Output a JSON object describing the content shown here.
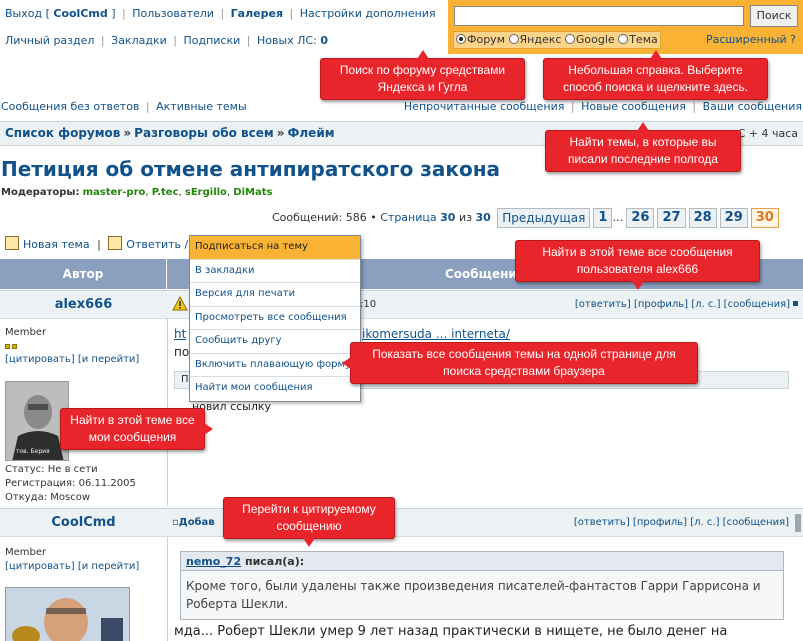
{
  "topbar": {
    "row1": {
      "logout_prefix": "Выход [",
      "logout_user": "CoolCmd",
      "logout_suffix": "]",
      "users": "Пользователи",
      "gallery": "Галерея",
      "addon_settings": "Настройки дополнения"
    },
    "row2": {
      "personal": "Личный раздел",
      "bookmarks": "Закладки",
      "subscriptions": "Подписки",
      "new_pm_label": "Новых ЛС:",
      "new_pm_count": "0"
    }
  },
  "search": {
    "button": "Поиск",
    "value": "",
    "options": [
      "Форум",
      "Яндекс",
      "Google",
      "Тема"
    ],
    "selected": "Форум",
    "advanced": "Расширенный",
    "help": "?"
  },
  "links": {
    "left": [
      "Сообщения без ответов",
      "Активные темы"
    ],
    "right": [
      "Непрочитанные сообщения",
      "Новые сообщения",
      "Ваши сообщения"
    ]
  },
  "breadcrumbs": [
    "Список форумов",
    "Разговоры обо всем",
    "Флейм"
  ],
  "timezone": "C + 4 часа",
  "topic": {
    "title": "Петиция об отмене антипиратского закона",
    "moderators_label": "Модераторы:",
    "moderators": [
      "master-pro",
      "P.tec",
      "sErgillo",
      "DiMats"
    ]
  },
  "pagination": {
    "messages_label": "Сообщений:",
    "messages_count": "586",
    "page_label": "Страница",
    "page_current": "30",
    "page_of": "из",
    "page_total": "30",
    "prev": "Предыдущая",
    "pages": [
      "1",
      "…",
      "26",
      "27",
      "28",
      "29",
      "30"
    ]
  },
  "actions": {
    "new_topic": "Новая тема",
    "reply": "Ответить"
  },
  "dropdown": [
    "Подписаться на тему",
    "В закладки",
    "Версия для печати",
    "Просмотреть все сообщения",
    "Сообщить другу",
    "Включить плавающую форму",
    "Найти мои сообщения"
  ],
  "table": {
    "author_col": "Автор",
    "messages_col": "Сообщение"
  },
  "posts": [
    {
      "author": "alex666",
      "rank": "Member",
      "cite": "[цитировать]",
      "goto": "[и перейти]",
      "status": "Статус: Не в сети",
      "registered": "Регистрация: 06.11.2005",
      "from": "Откуда: Moscow",
      "avatar_caption": "тов. Берия",
      "time_fragment": ":10",
      "links": [
        "[ответить]",
        "[профиль]",
        "[л. с.]",
        "[сообщения]"
      ],
      "body_link_start": "ht",
      "body_link_end": "ikomersuda ... interneta/",
      "body_line2": "по",
      "edit_prefix": "П",
      "edit_text": "новил ссылку"
    },
    {
      "author": "CoolCmd",
      "rank": "Member",
      "cite": "[цитировать]",
      "goto": "[и перейти]",
      "added_fragment": "Добав",
      "links": [
        "[ответить]",
        "[профиль]",
        "[л. с.]",
        "[сообщения]"
      ],
      "quote_author": "nemo_72",
      "quote_said": "писал(а):",
      "quote_text": "Кроме того, были удалены также произведения писателей-фантастов Гарри Гаррисона и Роберта Шекли.",
      "body": "мда... Роберт Шекли умер 9 лет назад практически в нищете, не было денег на"
    }
  ],
  "callouts": {
    "search_forum": "Поиск по форуму средствами Яндекса и Гугла",
    "search_help": "Небольшая справка. Выберите способ поиска и щелкните здесь.",
    "your_topics": "Найти темы, в которые вы писали последние полгода",
    "user_posts": "Найти в этой теме все сообщения пользователя alex666",
    "show_all": "Показать все сообщения темы на одной странице для поиска средствами браузера",
    "my_posts": "Найти в этой теме все мои сообщения",
    "goto_quote": "Перейти к цитируемому сообщению"
  },
  "colors": {
    "accent": "#f9b234",
    "link": "#105289",
    "callout": "#e8252b",
    "header": "#8aa0be",
    "moderator": "#23870a"
  }
}
